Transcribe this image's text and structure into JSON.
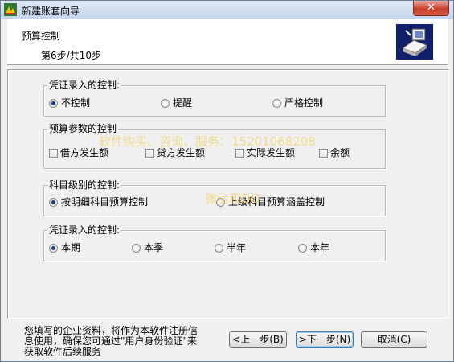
{
  "window": {
    "title": "新建账套向导",
    "close_label": "✕"
  },
  "header": {
    "title": "预算控制",
    "step": "第6步/共10步"
  },
  "groups": {
    "voucher1": {
      "legend": "凭证录入的控制:",
      "options": [
        "不控制",
        "提醒",
        "严格控制"
      ],
      "selected": 0
    },
    "params": {
      "legend": "预算参数的控制",
      "options": [
        "借方发生额",
        "贷方发生额",
        "实际发生额",
        "余额"
      ]
    },
    "level": {
      "legend": "科目级别的控制:",
      "options": [
        "按明细科目预算控制",
        "上级科目预算涵盖控制"
      ],
      "selected": 0
    },
    "voucher2": {
      "legend": "凭证录入的控制:",
      "options": [
        "本期",
        "本季",
        "半年",
        "本年"
      ],
      "selected": 0
    }
  },
  "watermark": {
    "line1": "软件购买、咨询、服务：15201068208",
    "line2": "微信和QQ"
  },
  "footer": {
    "note_line1": "您填写的企业资料，将作为本软件注册信",
    "note_line2": "息使用，确保您可通过\"用户身份验证\"来",
    "note_line3": "获取软件后续服务",
    "prev_label": "<上一步(B)",
    "next_label": ">下一步(N)",
    "cancel_label": "取消(C)"
  }
}
